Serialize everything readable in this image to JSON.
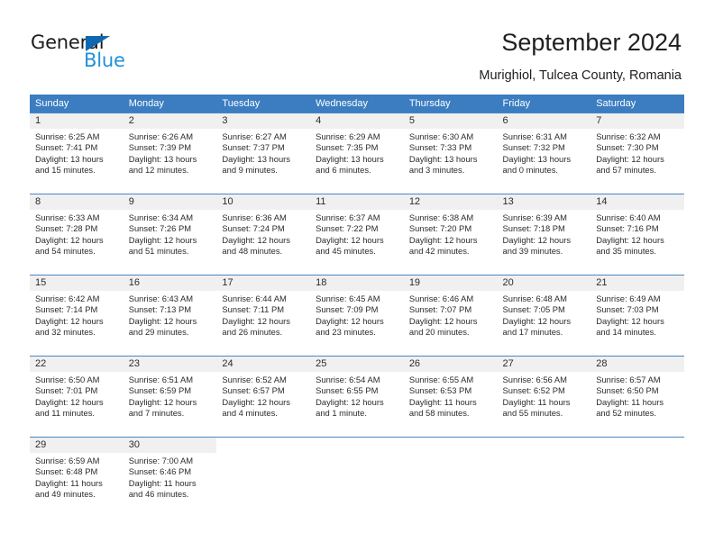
{
  "brand": {
    "name_part1": "General",
    "name_part2": "Blue"
  },
  "header": {
    "title": "September 2024",
    "subtitle": "Murighiol, Tulcea County, Romania"
  },
  "colors": {
    "header_blue": "#3b7dc0",
    "brand_blue": "#2191d8",
    "logo_triangle": "#0d68b1",
    "daynum_bg": "#f0f0f0",
    "text": "#2b2b2b"
  },
  "weekdays": [
    "Sunday",
    "Monday",
    "Tuesday",
    "Wednesday",
    "Thursday",
    "Friday",
    "Saturday"
  ],
  "weeks": [
    [
      {
        "day": "1",
        "sunrise": "Sunrise: 6:25 AM",
        "sunset": "Sunset: 7:41 PM",
        "daylight1": "Daylight: 13 hours",
        "daylight2": "and 15 minutes."
      },
      {
        "day": "2",
        "sunrise": "Sunrise: 6:26 AM",
        "sunset": "Sunset: 7:39 PM",
        "daylight1": "Daylight: 13 hours",
        "daylight2": "and 12 minutes."
      },
      {
        "day": "3",
        "sunrise": "Sunrise: 6:27 AM",
        "sunset": "Sunset: 7:37 PM",
        "daylight1": "Daylight: 13 hours",
        "daylight2": "and 9 minutes."
      },
      {
        "day": "4",
        "sunrise": "Sunrise: 6:29 AM",
        "sunset": "Sunset: 7:35 PM",
        "daylight1": "Daylight: 13 hours",
        "daylight2": "and 6 minutes."
      },
      {
        "day": "5",
        "sunrise": "Sunrise: 6:30 AM",
        "sunset": "Sunset: 7:33 PM",
        "daylight1": "Daylight: 13 hours",
        "daylight2": "and 3 minutes."
      },
      {
        "day": "6",
        "sunrise": "Sunrise: 6:31 AM",
        "sunset": "Sunset: 7:32 PM",
        "daylight1": "Daylight: 13 hours",
        "daylight2": "and 0 minutes."
      },
      {
        "day": "7",
        "sunrise": "Sunrise: 6:32 AM",
        "sunset": "Sunset: 7:30 PM",
        "daylight1": "Daylight: 12 hours",
        "daylight2": "and 57 minutes."
      }
    ],
    [
      {
        "day": "8",
        "sunrise": "Sunrise: 6:33 AM",
        "sunset": "Sunset: 7:28 PM",
        "daylight1": "Daylight: 12 hours",
        "daylight2": "and 54 minutes."
      },
      {
        "day": "9",
        "sunrise": "Sunrise: 6:34 AM",
        "sunset": "Sunset: 7:26 PM",
        "daylight1": "Daylight: 12 hours",
        "daylight2": "and 51 minutes."
      },
      {
        "day": "10",
        "sunrise": "Sunrise: 6:36 AM",
        "sunset": "Sunset: 7:24 PM",
        "daylight1": "Daylight: 12 hours",
        "daylight2": "and 48 minutes."
      },
      {
        "day": "11",
        "sunrise": "Sunrise: 6:37 AM",
        "sunset": "Sunset: 7:22 PM",
        "daylight1": "Daylight: 12 hours",
        "daylight2": "and 45 minutes."
      },
      {
        "day": "12",
        "sunrise": "Sunrise: 6:38 AM",
        "sunset": "Sunset: 7:20 PM",
        "daylight1": "Daylight: 12 hours",
        "daylight2": "and 42 minutes."
      },
      {
        "day": "13",
        "sunrise": "Sunrise: 6:39 AM",
        "sunset": "Sunset: 7:18 PM",
        "daylight1": "Daylight: 12 hours",
        "daylight2": "and 39 minutes."
      },
      {
        "day": "14",
        "sunrise": "Sunrise: 6:40 AM",
        "sunset": "Sunset: 7:16 PM",
        "daylight1": "Daylight: 12 hours",
        "daylight2": "and 35 minutes."
      }
    ],
    [
      {
        "day": "15",
        "sunrise": "Sunrise: 6:42 AM",
        "sunset": "Sunset: 7:14 PM",
        "daylight1": "Daylight: 12 hours",
        "daylight2": "and 32 minutes."
      },
      {
        "day": "16",
        "sunrise": "Sunrise: 6:43 AM",
        "sunset": "Sunset: 7:13 PM",
        "daylight1": "Daylight: 12 hours",
        "daylight2": "and 29 minutes."
      },
      {
        "day": "17",
        "sunrise": "Sunrise: 6:44 AM",
        "sunset": "Sunset: 7:11 PM",
        "daylight1": "Daylight: 12 hours",
        "daylight2": "and 26 minutes."
      },
      {
        "day": "18",
        "sunrise": "Sunrise: 6:45 AM",
        "sunset": "Sunset: 7:09 PM",
        "daylight1": "Daylight: 12 hours",
        "daylight2": "and 23 minutes."
      },
      {
        "day": "19",
        "sunrise": "Sunrise: 6:46 AM",
        "sunset": "Sunset: 7:07 PM",
        "daylight1": "Daylight: 12 hours",
        "daylight2": "and 20 minutes."
      },
      {
        "day": "20",
        "sunrise": "Sunrise: 6:48 AM",
        "sunset": "Sunset: 7:05 PM",
        "daylight1": "Daylight: 12 hours",
        "daylight2": "and 17 minutes."
      },
      {
        "day": "21",
        "sunrise": "Sunrise: 6:49 AM",
        "sunset": "Sunset: 7:03 PM",
        "daylight1": "Daylight: 12 hours",
        "daylight2": "and 14 minutes."
      }
    ],
    [
      {
        "day": "22",
        "sunrise": "Sunrise: 6:50 AM",
        "sunset": "Sunset: 7:01 PM",
        "daylight1": "Daylight: 12 hours",
        "daylight2": "and 11 minutes."
      },
      {
        "day": "23",
        "sunrise": "Sunrise: 6:51 AM",
        "sunset": "Sunset: 6:59 PM",
        "daylight1": "Daylight: 12 hours",
        "daylight2": "and 7 minutes."
      },
      {
        "day": "24",
        "sunrise": "Sunrise: 6:52 AM",
        "sunset": "Sunset: 6:57 PM",
        "daylight1": "Daylight: 12 hours",
        "daylight2": "and 4 minutes."
      },
      {
        "day": "25",
        "sunrise": "Sunrise: 6:54 AM",
        "sunset": "Sunset: 6:55 PM",
        "daylight1": "Daylight: 12 hours",
        "daylight2": "and 1 minute."
      },
      {
        "day": "26",
        "sunrise": "Sunrise: 6:55 AM",
        "sunset": "Sunset: 6:53 PM",
        "daylight1": "Daylight: 11 hours",
        "daylight2": "and 58 minutes."
      },
      {
        "day": "27",
        "sunrise": "Sunrise: 6:56 AM",
        "sunset": "Sunset: 6:52 PM",
        "daylight1": "Daylight: 11 hours",
        "daylight2": "and 55 minutes."
      },
      {
        "day": "28",
        "sunrise": "Sunrise: 6:57 AM",
        "sunset": "Sunset: 6:50 PM",
        "daylight1": "Daylight: 11 hours",
        "daylight2": "and 52 minutes."
      }
    ],
    [
      {
        "day": "29",
        "sunrise": "Sunrise: 6:59 AM",
        "sunset": "Sunset: 6:48 PM",
        "daylight1": "Daylight: 11 hours",
        "daylight2": "and 49 minutes."
      },
      {
        "day": "30",
        "sunrise": "Sunrise: 7:00 AM",
        "sunset": "Sunset: 6:46 PM",
        "daylight1": "Daylight: 11 hours",
        "daylight2": "and 46 minutes."
      },
      {
        "day": "",
        "sunrise": "",
        "sunset": "",
        "daylight1": "",
        "daylight2": ""
      },
      {
        "day": "",
        "sunrise": "",
        "sunset": "",
        "daylight1": "",
        "daylight2": ""
      },
      {
        "day": "",
        "sunrise": "",
        "sunset": "",
        "daylight1": "",
        "daylight2": ""
      },
      {
        "day": "",
        "sunrise": "",
        "sunset": "",
        "daylight1": "",
        "daylight2": ""
      },
      {
        "day": "",
        "sunrise": "",
        "sunset": "",
        "daylight1": "",
        "daylight2": ""
      }
    ]
  ]
}
